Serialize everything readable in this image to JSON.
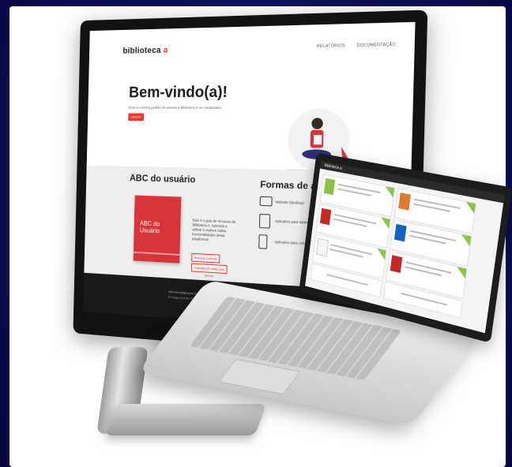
{
  "desktop": {
    "logo_text": "biblioteca",
    "logo_accent": "a",
    "nav": [
      "RELATÓRIOS",
      "DOCUMENTAÇÃO"
    ],
    "hero_title": "Bem-vindo(a)!",
    "hero_subtitle": "Essa é a forma padrão de acesso à Biblioteca A no computador.",
    "hero_button": "Acessar",
    "abc_title": "ABC do usuário",
    "book_title": "ABC do Usuário",
    "book_description": "Este é o guia de recursos da Biblioteca A. Aprenda a utilizar e explore todas funcionalidades desta plataforma!",
    "link_ebook": "Acessar o ebook",
    "link_videos": "Tutoriais em vídeo (em breve)",
    "access_title": "Formas de acesso",
    "access_items": [
      "Website (desktop)",
      "Aplicativo para tablet",
      "Aplicativo para celular"
    ],
    "footer_lines": [
      "biblioteca@grupoa.com.br",
      "© Grupo A 2020. Todos os direitos reservados."
    ]
  },
  "laptop": {
    "logo_text": "biblioteca a"
  },
  "colors": {
    "accent": "#e63b2e",
    "background": "#0c1060",
    "badge": "#8bc34a"
  }
}
